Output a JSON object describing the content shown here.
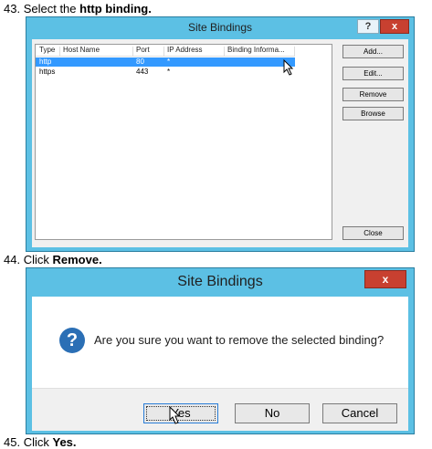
{
  "steps": [
    {
      "number": "43.",
      "text": "Select the ",
      "bold": "http binding."
    },
    {
      "number": "44.",
      "text": "Click ",
      "bold": "Remove."
    },
    {
      "number": "45.",
      "text": "Click ",
      "bold": "Yes."
    }
  ],
  "bindings_window": {
    "title": "Site Bindings",
    "help_label": "?",
    "close_label": "x",
    "columns": [
      "Type",
      "Host Name",
      "Port",
      "IP Address",
      "Binding Informa..."
    ],
    "rows": [
      {
        "type": "http",
        "host": "",
        "port": "80",
        "ip": "*",
        "info": "",
        "selected": true
      },
      {
        "type": "https",
        "host": "",
        "port": "443",
        "ip": "*",
        "info": "",
        "selected": false
      }
    ],
    "buttons": {
      "add": "Add...",
      "edit": "Edit...",
      "remove": "Remove",
      "browse": "Browse",
      "close": "Close"
    }
  },
  "confirm_dialog": {
    "title": "Site Bindings",
    "close_label": "x",
    "icon": "question-icon",
    "message": "Are you sure you want to remove the selected binding?",
    "buttons": {
      "yes": "Yes",
      "no": "No",
      "cancel": "Cancel"
    }
  },
  "colors": {
    "title_bar": "#5cc0e4",
    "selection": "#3399ff",
    "close": "#c84030",
    "question": "#2b6fb5"
  }
}
